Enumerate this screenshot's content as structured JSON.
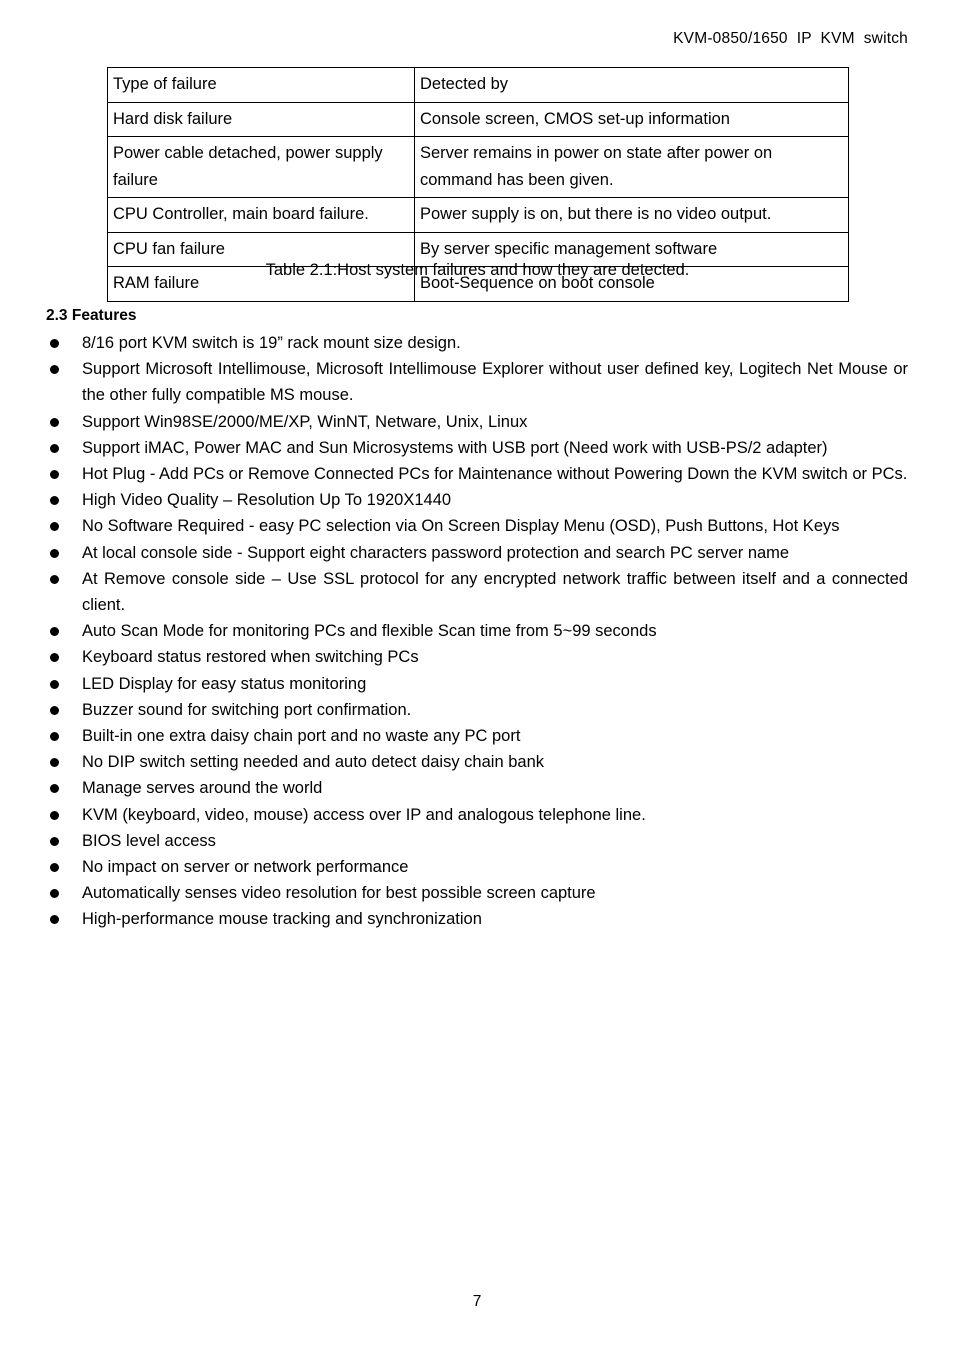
{
  "header": {
    "running_title": "KVM-0850/1650  IP  KVM  switch"
  },
  "table": {
    "caption": "Table 2.1:Host system failures and how they are detected.",
    "columns": [
      "Type of failure",
      "Detected by"
    ],
    "rows": [
      [
        "Hard disk failure",
        "Console screen, CMOS set-up information"
      ],
      [
        "Power cable detached, power supply failure",
        "Server remains in power on state after power on command has been given."
      ],
      [
        "CPU Controller, main board failure.",
        "Power supply is on, but there is no video output."
      ],
      [
        "CPU fan failure",
        "By server specific management software"
      ],
      [
        "RAM failure",
        "Boot-Sequence on boot console"
      ]
    ]
  },
  "features_section": {
    "heading": "2.3 Features",
    "items": [
      "8/16 port KVM switch is 19” rack mount size design.",
      "Support Microsoft Intellimouse, Microsoft Intellimouse Explorer without user defined key, Logitech Net Mouse or the other fully compatible MS mouse.",
      "Support Win98SE/2000/ME/XP, WinNT, Netware, Unix, Linux",
      "Support iMAC, Power MAC and Sun Microsystems with USB port (Need work with USB-PS/2 adapter)",
      "Hot Plug - Add PCs or Remove Connected PCs for Maintenance without Powering Down the KVM switch or PCs.",
      "High Video Quality – Resolution Up To 1920X1440",
      "No Software Required - easy PC selection via On Screen Display Menu (OSD), Push Buttons, Hot Keys",
      "At local console side - Support eight characters password protection and search PC server name",
      "At Remove console side – Use SSL protocol for any encrypted network traffic between itself and a connected client.",
      "Auto Scan Mode for monitoring PCs and flexible Scan time from 5~99 seconds",
      "Keyboard status restored when switching PCs",
      "LED Display for easy status monitoring",
      "Buzzer sound for switching port confirmation.",
      "Built-in one extra daisy chain port and no waste any PC port",
      "No DIP switch setting needed and auto detect daisy chain bank",
      "Manage serves around the world",
      "KVM (keyboard, video, mouse) access over IP and analogous telephone line.",
      "BIOS level access",
      "No impact on server or network performance",
      "Automatically senses video resolution for best possible screen capture",
      "High-performance mouse tracking and synchronization"
    ]
  },
  "footer": {
    "page_number": "7"
  }
}
